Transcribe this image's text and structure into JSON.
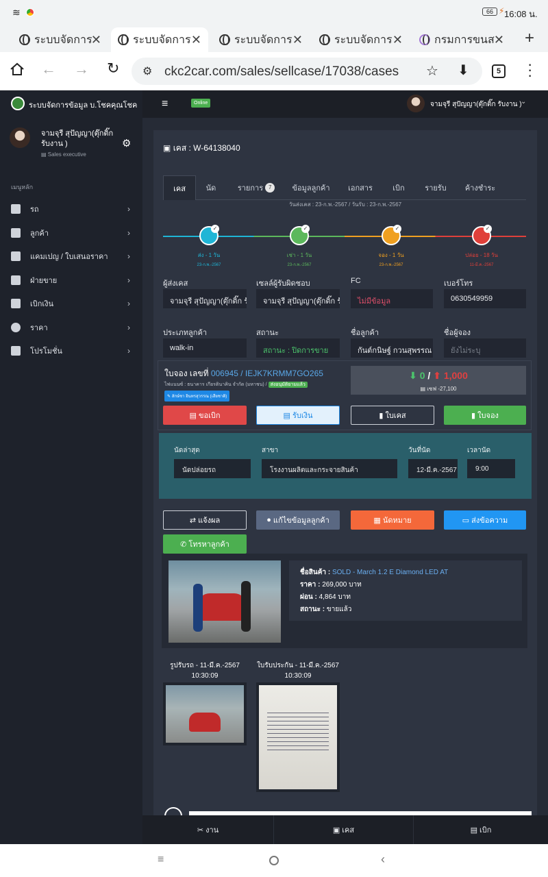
{
  "status": {
    "battery": "66",
    "time": "16:08 น."
  },
  "browser": {
    "tabs": [
      {
        "title": "ระบบจัดการ"
      },
      {
        "title": "ระบบจัดการ"
      },
      {
        "title": "ระบบจัดการ"
      },
      {
        "title": "ระบบจัดการ"
      },
      {
        "title": "กรมการขนส"
      }
    ],
    "url": "ckc2car.com/sales/sellcase/17038/cases",
    "tab_count": "5"
  },
  "app": {
    "brand": "ระบบจัดการข้อมูล บ.โชคคุณโชค",
    "online_badge": "Online",
    "topbar_user": "จามจุรี สุปัญญา(ตุ๊กติ๊ก รับงาน )"
  },
  "sidebar": {
    "user_name": "จามจุรี สุปัญญา(ตุ๊กติ๊ก รับงาน )",
    "user_role": "Sales executive",
    "menu_title": "เมนูหลัก",
    "items": [
      {
        "label": "รถ"
      },
      {
        "label": "ลูกค้า"
      },
      {
        "label": "แคมเปญ / ใบเสนอราคา"
      },
      {
        "label": "ฝ่ายขาย"
      },
      {
        "label": "เบิกเงิน"
      },
      {
        "label": "ราคา"
      },
      {
        "label": "โปรโมชั่น"
      }
    ]
  },
  "case": {
    "header": "เคส : W-64138040",
    "tabs": [
      {
        "label": "เคส"
      },
      {
        "label": "นัด"
      },
      {
        "label": "รายการ"
      },
      {
        "label": "ข้อมูลลูกค้า"
      },
      {
        "label": "เอกสาร"
      },
      {
        "label": "เบิก"
      },
      {
        "label": "รายรับ"
      },
      {
        "label": "ค้างชำระ"
      }
    ],
    "items_badge": "7",
    "dates_line": "วันส่งเคส : 23-ก.พ.-2567 / วันรับ : 23-ก.พ.-2567",
    "steps": [
      {
        "label": "ส่ง - 1 วัน",
        "date": "23-ก.พ.-2567",
        "color": "#1fb5d6"
      },
      {
        "label": "เช่า - 1 วัน",
        "date": "23-ก.พ.-2567",
        "color": "#5cb85c"
      },
      {
        "label": "จอง - 1 วัน",
        "date": "23-ก.พ.-2567",
        "color": "#f0a020"
      },
      {
        "label": "ปล่อย - 18 วัน",
        "date": "11-มี.ค.-2567",
        "color": "#e0403a"
      }
    ],
    "fields": {
      "sender_label": "ผู้ส่งเคส",
      "sender": "จามจุรี สุปัญญา(ตุ๊กติ๊ก รับงาน)",
      "sales_label": "เซลล์ผู้รับผิดชอบ",
      "sales": "จามจุรี สุปัญญา(ตุ๊กติ๊ก รับงาน)",
      "fc_label": "FC",
      "fc": "ไม่มีข้อมูล",
      "phone_label": "เบอร์โทร",
      "phone": "0630549959",
      "cust_type_label": "ประเภทลูกค้า",
      "cust_type": "walk-in",
      "status_label": "สถานะ",
      "status": "สถานะ : ปิดการขาย",
      "cust_name_label": "ชื่อลูกค้า",
      "cust_name": "กันต์กนิษฐ์ กวนสุพรรณ",
      "booker_label": "ชื่อผู้จอง",
      "booker": "ยังไม่ระบุ"
    }
  },
  "booking": {
    "title_prefix": "ใบจอง เลขที่",
    "number": "006945 / IEJK7KRMM7GO265",
    "finance": "ไฟแนนซ์ : ธนาคาร เกียรตินาคิน จำกัด (มหาชน) /",
    "finance_badge": "ส่งอนุมัติยามแล้ว",
    "tag": "ลักษ์ชา อินทรสุวรรณ (เสียชาติ)",
    "down": "0",
    "slash": "/",
    "up": "1,000",
    "net": "เซฟ -27,100",
    "btn_withdraw": "ขอเบิก",
    "btn_receive": "รับเงิน",
    "btn_case": "ใบเคส",
    "btn_booking": "ใบจอง"
  },
  "appointment": {
    "latest_label": "นัดล่าสุด",
    "latest": "นัดปล่อยรถ",
    "branch_label": "สาขา",
    "branch": "โรงงานผลิตและกระจายสินค้า",
    "date_label": "วันที่นัด",
    "date": "12-มี.ค.-2567",
    "time_label": "เวลานัด",
    "time": "9:00"
  },
  "actions": {
    "report": "แจ้งผล",
    "edit_customer": "แก้ไขข้อมูลลูกค้า",
    "appointment": "นัดหมาย",
    "send_message": "ส่งข้อความ",
    "call": "โทรหาลูกค้า"
  },
  "product": {
    "name_label": "ชื่อสินค้า :",
    "name": "SOLD - March 1.2 E Diamond LED AT",
    "price_label": "ราคา :",
    "price": "269,000 บาท",
    "installment_label": "ผ่อน :",
    "installment": "4,864 บาท",
    "status_label": "สถานะ :",
    "status": "ขายแล้ว"
  },
  "docs": [
    {
      "caption": "รูปรับรถ - 11-มี.ค.-2567",
      "time": "10:30:09"
    },
    {
      "caption": "ใบรับประกัน - 11-มี.ค.-2567",
      "time": "10:30:09"
    }
  ],
  "bottomnav": {
    "work": "งาน",
    "case": "เคส",
    "withdraw": "เบิก"
  }
}
